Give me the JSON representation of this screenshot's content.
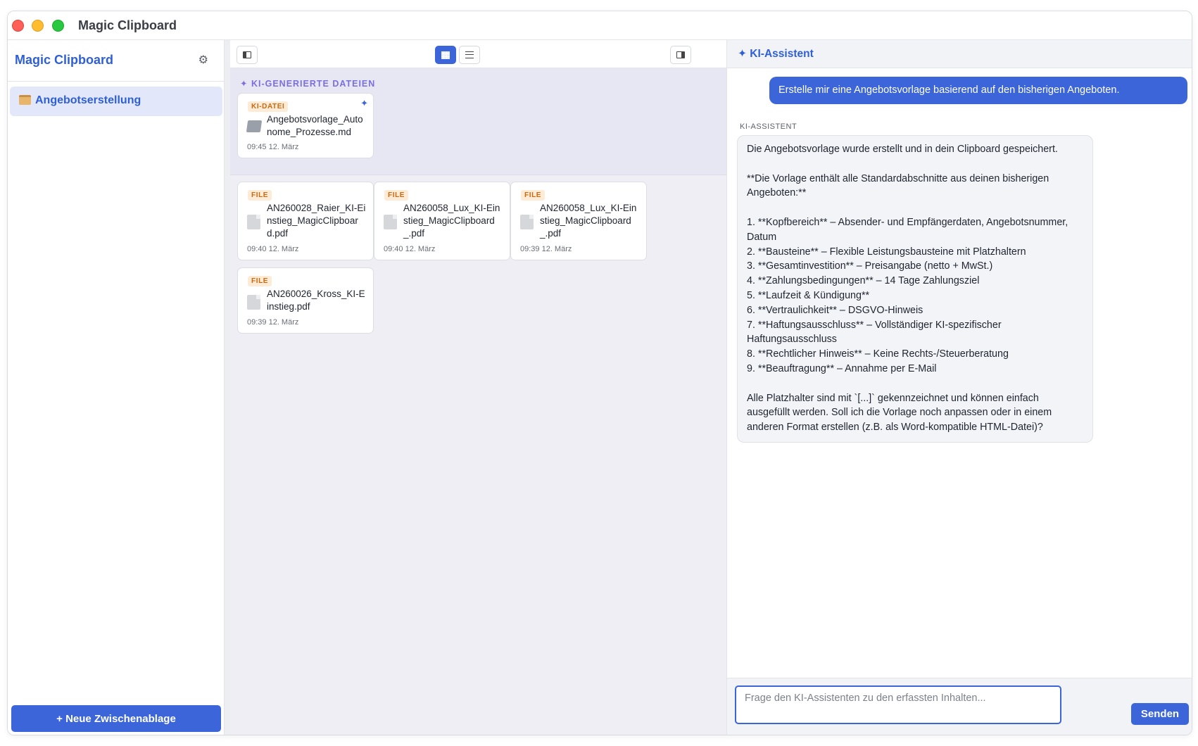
{
  "window": {
    "title": "Magic Clipboard"
  },
  "sidebar": {
    "title": "Magic Clipboard",
    "settings_icon": "gear-icon",
    "items": [
      {
        "label": "Angebotserstellung",
        "icon": "folder-icon"
      }
    ],
    "new_button": "+ Neue Zwischenablage"
  },
  "toolbar": {
    "left_icon": "sidebar-toggle-icon",
    "grid_icon": "grid-view-icon",
    "list_icon": "list-view-icon",
    "right_icon": "assistant-panel-toggle-icon"
  },
  "ai_files": {
    "heading": "✦ KI-GENERIERTE DATEIEN",
    "items": [
      {
        "badge": "KI-DATEI",
        "name": "Angebotsvorlage_Autonome_Prozesse.md",
        "date": "09:45 12. März",
        "sparkle": "✦"
      }
    ]
  },
  "files": [
    {
      "badge": "FILE",
      "name": "AN260028_Raier_KI-Einstieg_MagicClipboard.pdf",
      "date": "09:40 12. März"
    },
    {
      "badge": "FILE",
      "name": "AN260058_Lux_KI-Einstieg_MagicClipboard_.pdf",
      "date": "09:40 12. März"
    },
    {
      "badge": "FILE",
      "name": "AN260058_Lux_KI-Einstieg_MagicClipboard_.pdf",
      "date": "09:39 12. März"
    },
    {
      "badge": "FILE",
      "name": "AN260026_Kross_KI-Einstieg.pdf",
      "date": "09:39 12. März"
    }
  ],
  "assistant": {
    "title": "✦ KI-Assistent",
    "user_message": "Erstelle mir eine Angebotsvorlage basierend auf den bisherigen Angeboten.",
    "ai_label": "KI-ASSISTENT",
    "ai_message_lines": [
      "Die Angebotsvorlage wurde erstellt und in dein Clipboard gespeichert.",
      "",
      "**Die Vorlage enthält alle Standardabschnitte aus deinen bisherigen Angeboten:**",
      "",
      "1. **Kopfbereich** – Absender- und Empfängerdaten, Angebotsnummer, Datum",
      "2. **Bausteine** – Flexible Leistungsbausteine mit Platzhaltern",
      "3. **Gesamtinvestition** – Preisangabe (netto + MwSt.)",
      "4. **Zahlungsbedingungen** – 14 Tage Zahlungsziel",
      "5. **Laufzeit & Kündigung**",
      "6. **Vertraulichkeit** – DSGVO-Hinweis",
      "7. **Haftungsausschluss** – Vollständiger KI-spezifischer Haftungsausschluss",
      "8. **Rechtlicher Hinweis** – Keine Rechts-/Steuerberatung",
      "9. **Beauftragung** – Annahme per E-Mail",
      "",
      "Alle Platzhalter sind mit `[...]` gekennzeichnet und können einfach ausgefüllt werden. Soll ich die Vorlage noch anpassen oder in einem anderen Format erstellen (z.B. als Word-kompatible HTML-Datei)?"
    ],
    "input_placeholder": "Frage den KI-Assistenten zu den erfassten Inhalten...",
    "input_value": "",
    "send_label": "Senden"
  }
}
